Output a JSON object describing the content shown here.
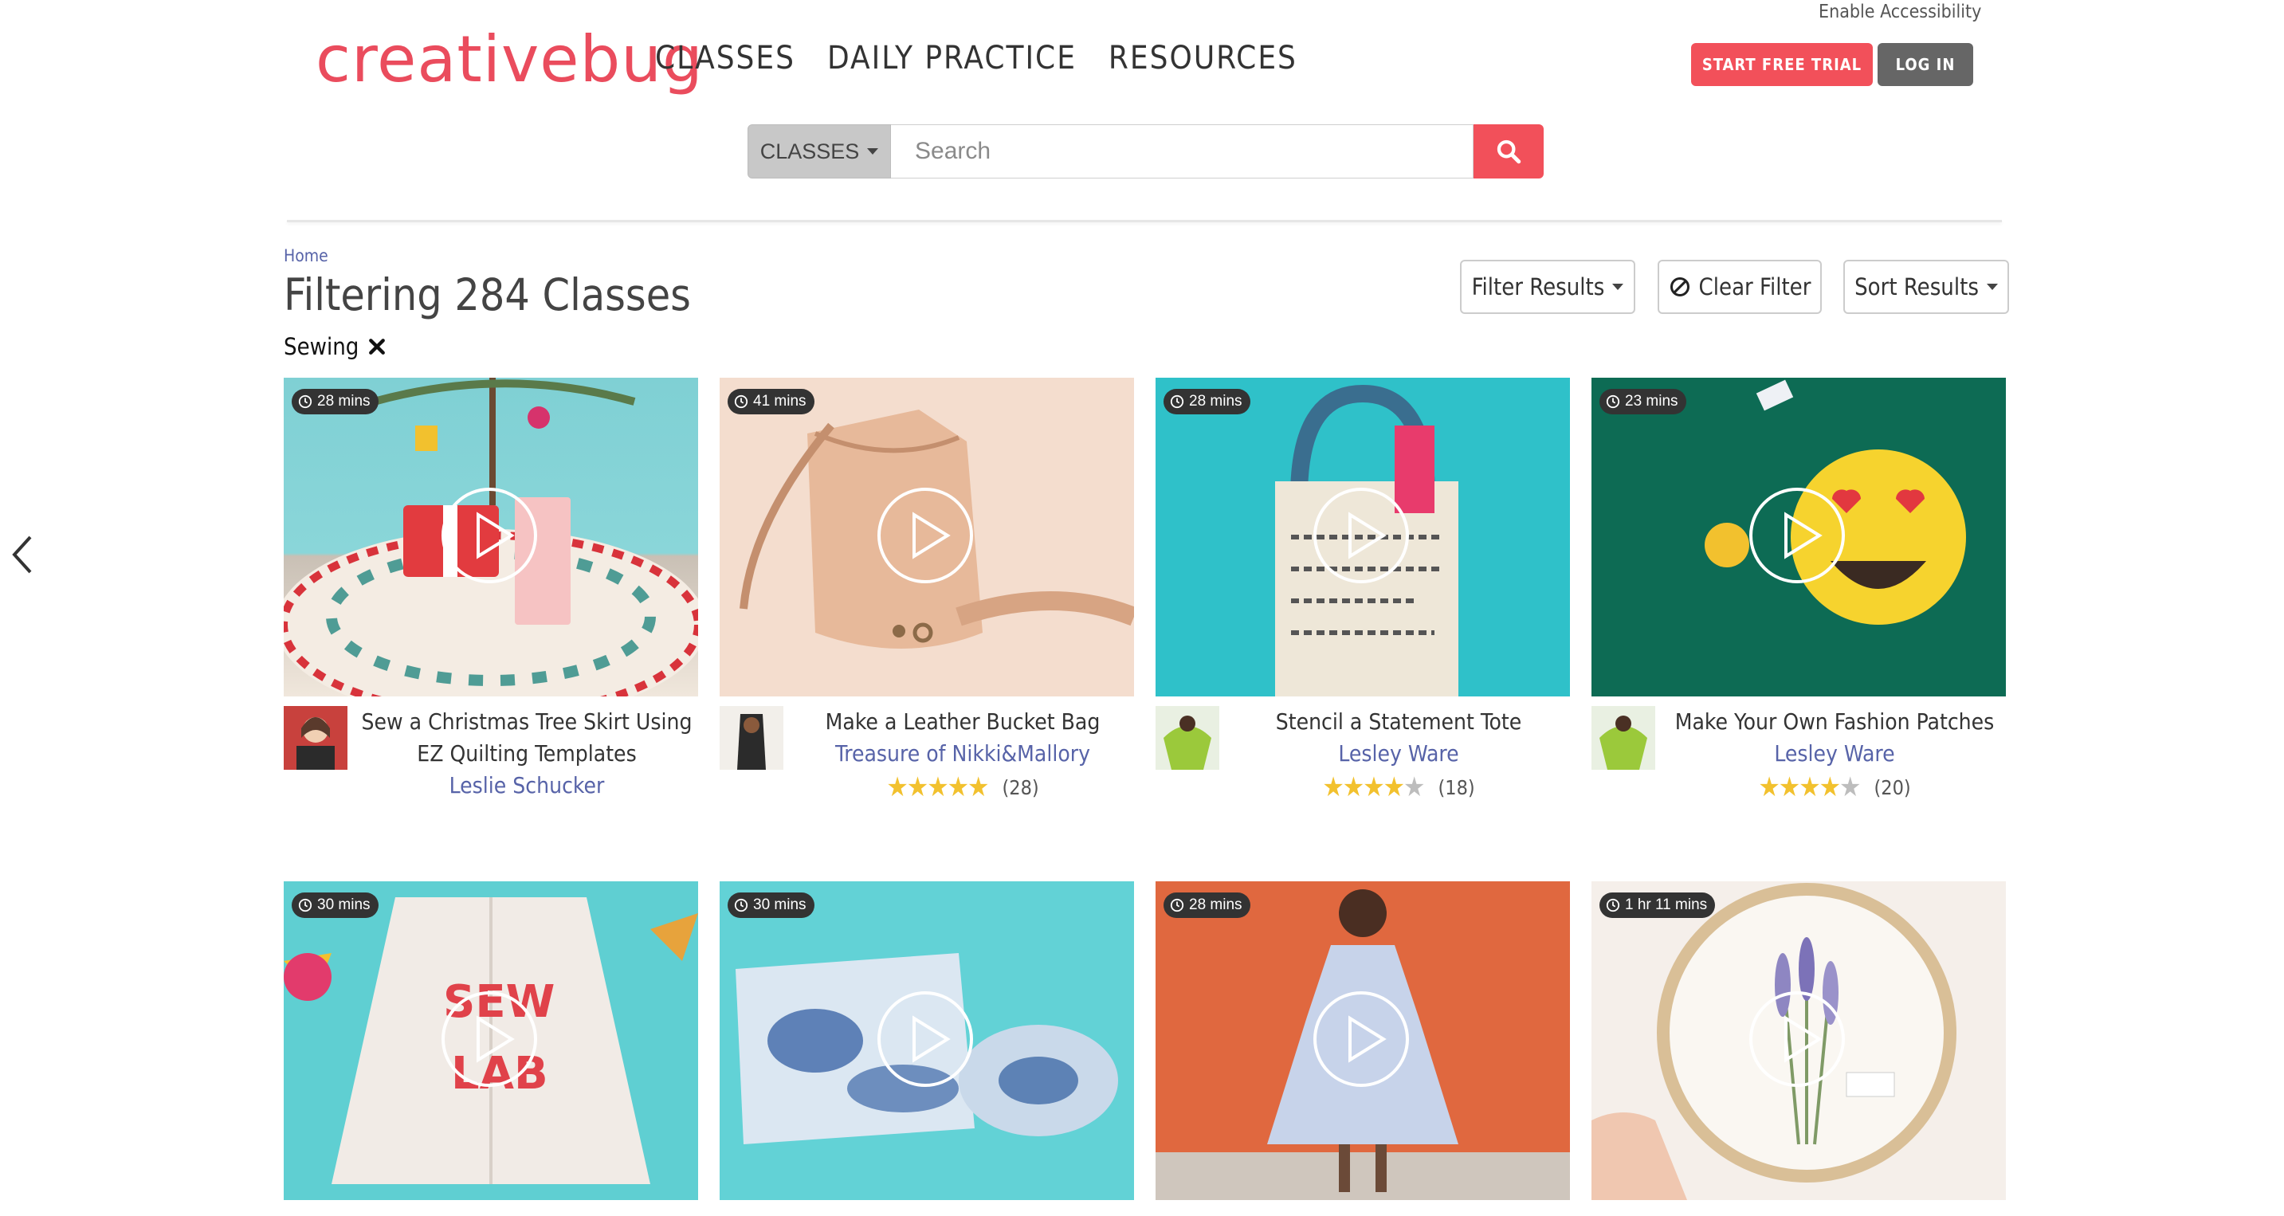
{
  "header": {
    "accessibility": "Enable Accessibility",
    "logo": "creativebug",
    "nav": [
      "CLASSES",
      "DAILY PRACTICE",
      "RESOURCES"
    ],
    "start_trial": "START FREE TRIAL",
    "log_in": "LOG IN"
  },
  "search": {
    "category": "CLASSES",
    "placeholder": "Search"
  },
  "breadcrumb": "Home",
  "title": "Filtering 284 Classes",
  "active_filter": "Sewing",
  "toolbar": {
    "filter": "Filter Results",
    "clear": "Clear Filter",
    "sort": "Sort Results"
  },
  "colors": {
    "brand": "#ea4c5d",
    "accent_button": "#f2505a",
    "author_link": "#5763a8",
    "star": "#f2c12e"
  },
  "cards": [
    {
      "duration": "28 mins",
      "title": "Sew a Christmas Tree Skirt Using EZ Quilting Templates",
      "author": "Leslie Schucker",
      "rating": null,
      "count": ""
    },
    {
      "duration": "41 mins",
      "title": "Make a Leather Bucket Bag",
      "author": "Treasure of Nikki&Mallory",
      "rating": 5,
      "count": "(28)"
    },
    {
      "duration": "28 mins",
      "title": "Stencil a Statement Tote",
      "author": "Lesley Ware",
      "rating": 4,
      "count": "(18)"
    },
    {
      "duration": "23 mins",
      "title": "Make Your Own Fashion Patches",
      "author": "Lesley Ware",
      "rating": 4,
      "count": "(20)"
    },
    {
      "duration": "30 mins",
      "title": "",
      "author": "",
      "rating": null,
      "count": ""
    },
    {
      "duration": "30 mins",
      "title": "",
      "author": "",
      "rating": null,
      "count": ""
    },
    {
      "duration": "28 mins",
      "title": "",
      "author": "",
      "rating": null,
      "count": ""
    },
    {
      "duration": "1 hr 11 mins",
      "title": "",
      "author": "",
      "rating": null,
      "count": ""
    }
  ]
}
